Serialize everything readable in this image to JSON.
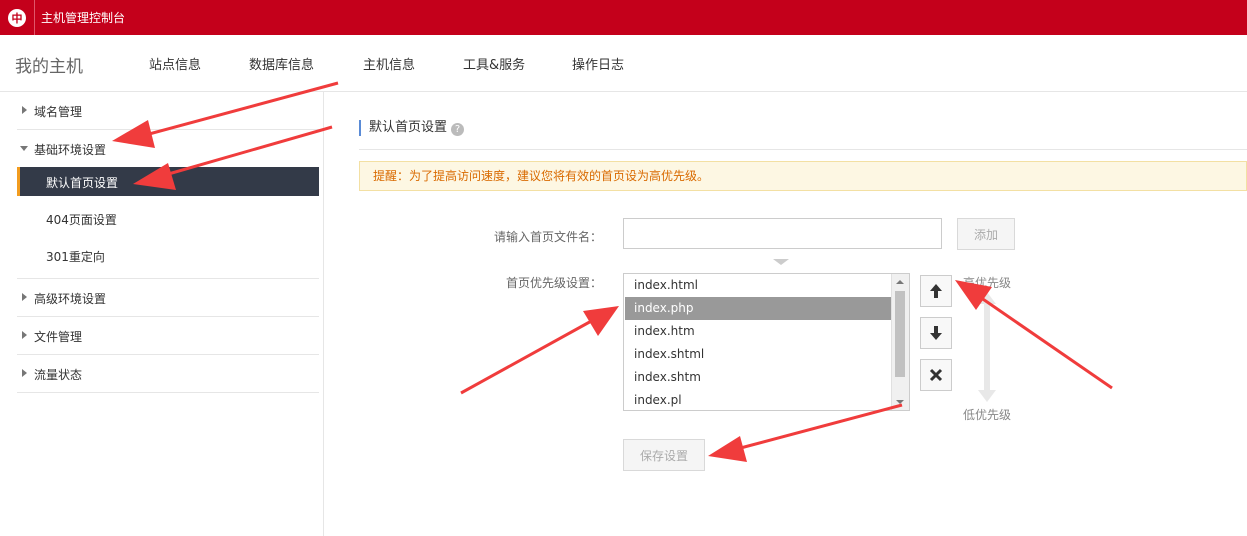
{
  "app": {
    "title": "主机管理控制台",
    "logo_text": "中"
  },
  "nav": {
    "brand": "我的主机",
    "items": [
      "站点信息",
      "数据库信息",
      "主机信息",
      "工具&服务",
      "操作日志"
    ]
  },
  "sidebar": {
    "domain": "域名管理",
    "basic_env": "基础环境设置",
    "sub": [
      "默认首页设置",
      "404页面设置",
      "301重定向"
    ],
    "advanced_env": "高级环境设置",
    "file_mgmt": "文件管理",
    "traffic": "流量状态"
  },
  "main": {
    "section_title": "默认首页设置",
    "help_glyph": "?",
    "notice": "提醒：为了提高访问速度，建议您将有效的首页设为高优先级。",
    "input_label": "请输入首页文件名：",
    "input_value": "",
    "add_button": "添加",
    "priority_label": "首页优先级设置：",
    "files": [
      "index.html",
      "index.php",
      "index.htm",
      "index.shtml",
      "index.shtm",
      "index.pl"
    ],
    "selected_index": 1,
    "high_priority": "高优先级",
    "low_priority": "低优先级",
    "save_button": "保存设置"
  },
  "colors": {
    "brand_red": "#c4001b",
    "active_bg": "#333a48",
    "active_accent": "#f29c1f",
    "annotation_red": "#f03c3c"
  }
}
